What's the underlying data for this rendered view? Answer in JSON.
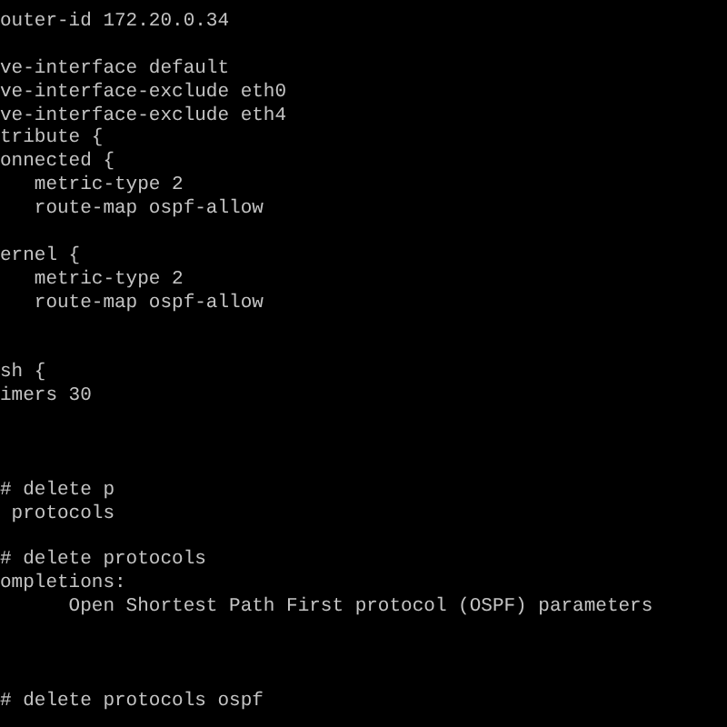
{
  "terminal": {
    "lines": [
      {
        "kind": "text",
        "text": "outer-id 172.20.0.34"
      },
      {
        "kind": "blank"
      },
      {
        "kind": "text",
        "text": "ve-interface default"
      },
      {
        "kind": "text",
        "text": "ve-interface-exclude eth0"
      },
      {
        "kind": "text",
        "text": "ve-interface-exclude eth4"
      },
      {
        "kind": "text",
        "text": "tribute {"
      },
      {
        "kind": "text",
        "text": "onnected {"
      },
      {
        "kind": "text",
        "text": "   metric-type 2"
      },
      {
        "kind": "text",
        "text": "   route-map ospf-allow"
      },
      {
        "kind": "blank"
      },
      {
        "kind": "text",
        "text": "ernel {"
      },
      {
        "kind": "text",
        "text": "   metric-type 2"
      },
      {
        "kind": "text",
        "text": "   route-map ospf-allow"
      },
      {
        "kind": "blank"
      },
      {
        "kind": "blank"
      },
      {
        "kind": "text",
        "text": "sh {"
      },
      {
        "kind": "text",
        "text": "imers 30"
      },
      {
        "kind": "blank"
      },
      {
        "kind": "blank"
      },
      {
        "kind": "blank"
      },
      {
        "kind": "text",
        "text": "# delete p"
      },
      {
        "kind": "text",
        "text": " protocols"
      },
      {
        "kind": "blank"
      },
      {
        "kind": "text",
        "text": "# delete protocols"
      },
      {
        "kind": "text",
        "text": "ompletions:"
      },
      {
        "kind": "text",
        "text": "      Open Shortest Path First protocol (OSPF) parameters"
      },
      {
        "kind": "blank"
      },
      {
        "kind": "blank"
      },
      {
        "kind": "blank"
      },
      {
        "kind": "text",
        "text": "# delete protocols ospf"
      }
    ]
  }
}
